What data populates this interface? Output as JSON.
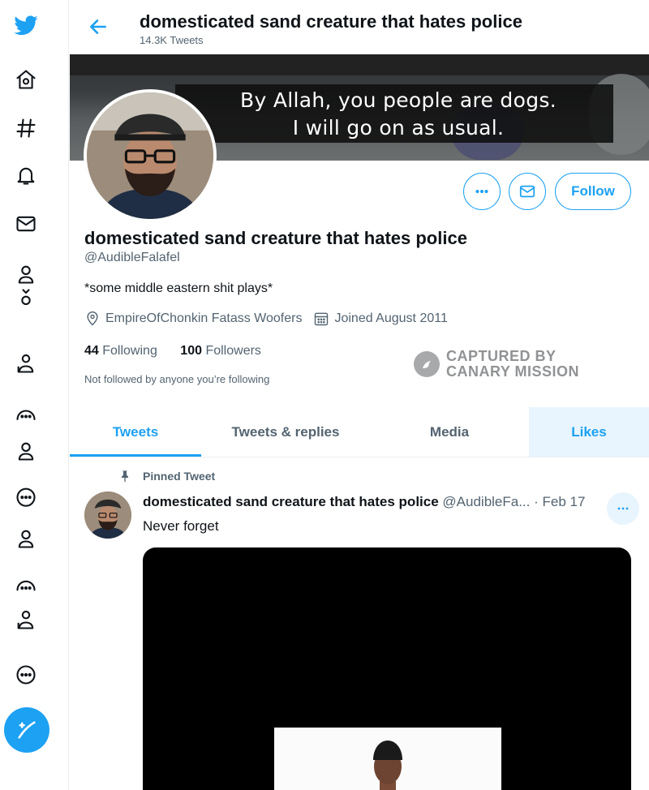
{
  "rail": {
    "icons": [
      "twitter-logo",
      "home-icon",
      "explore-icon",
      "notifications-icon",
      "messages-icon",
      "bookmarks-icon",
      "lists-icon",
      "profile-icon",
      "more-icon",
      "compose-tweet-icon"
    ]
  },
  "header": {
    "title": "domesticated sand creature that hates police",
    "tweet_count": "14.3K Tweets"
  },
  "banner": {
    "caption_line1": "By Allah, you people are dogs.",
    "caption_line2": "I will go on as usual."
  },
  "actions": {
    "follow_label": "Follow",
    "accent_color": "#1da1f2"
  },
  "profile": {
    "name": "domesticated sand creature that hates police",
    "handle": "@AudibleFalafel",
    "bio": "*some middle eastern shit plays*",
    "location": "EmpireOfChonkin Fatass Woofers",
    "joined": "Joined August 2011",
    "following_count": "44",
    "following_label": "Following",
    "followers_count": "100",
    "followers_label": "Followers",
    "not_followed": "Not followed by anyone you’re following"
  },
  "watermark": {
    "line1": "CAPTURED BY",
    "line2": "CANARY MISSION"
  },
  "tabs": [
    {
      "label": "Tweets"
    },
    {
      "label": "Tweets & replies"
    },
    {
      "label": "Media"
    },
    {
      "label": "Likes"
    }
  ],
  "tweet": {
    "pinned_label": "Pinned Tweet",
    "author_name": "domesticated sand creature that hates police",
    "author_handle": "@AudibleFa...",
    "date": "· Feb 17",
    "text": "Never forget"
  }
}
